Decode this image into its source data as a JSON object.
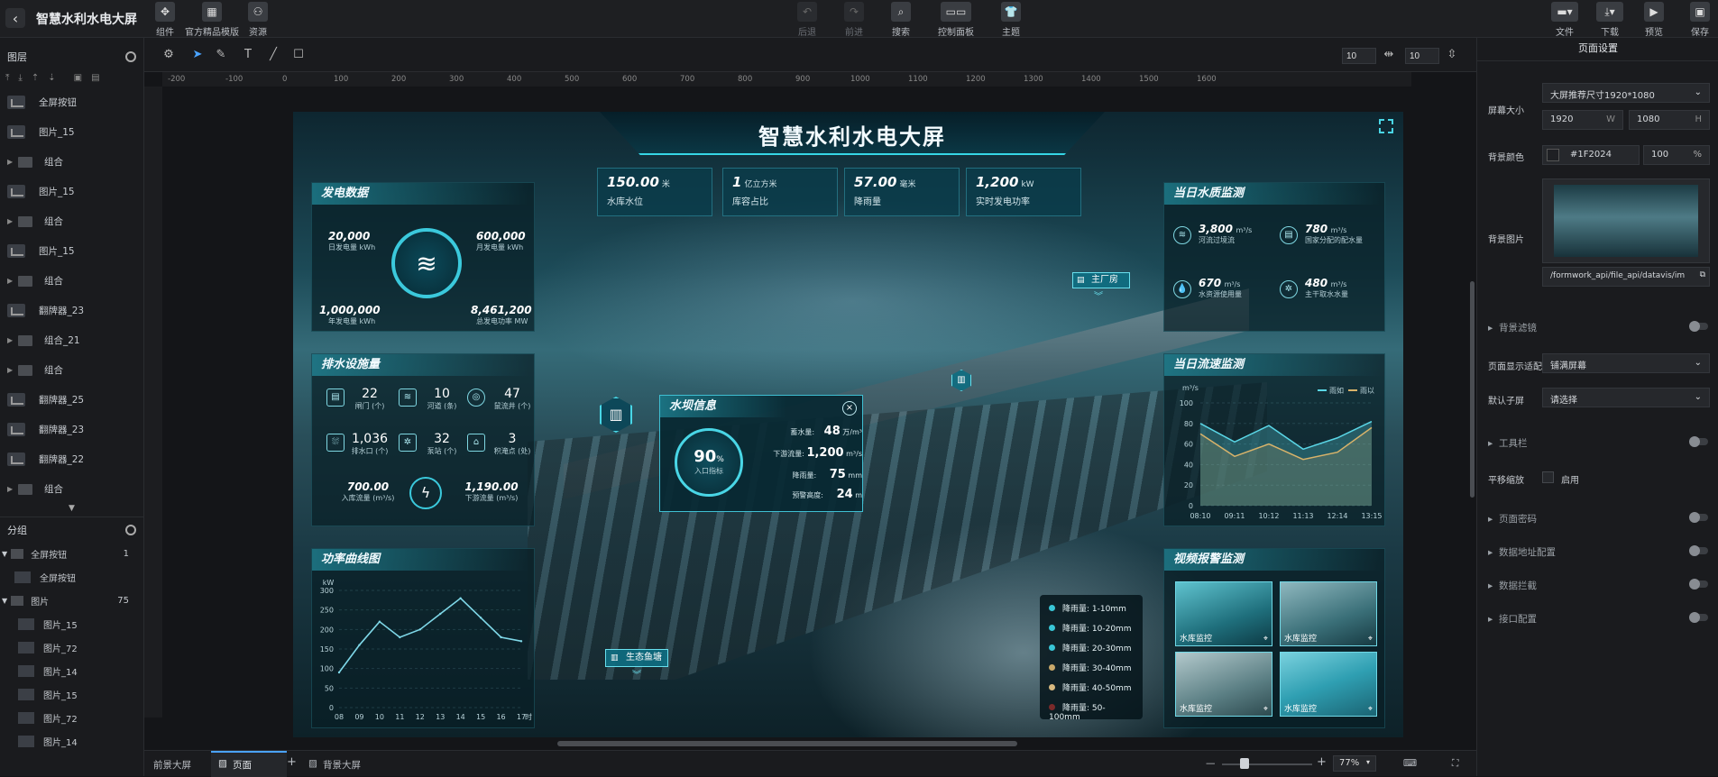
{
  "app": {
    "title": "智慧水利水电大屏"
  },
  "toolbar": {
    "left": [
      "组件",
      "官方精品模版",
      "资源"
    ],
    "center": [
      "后退",
      "前进",
      "搜索",
      "控制面板",
      "主题"
    ],
    "right": [
      "文件",
      "下载",
      "预览",
      "保存"
    ]
  },
  "layers": {
    "title": "图层",
    "items": [
      "全屏按钮",
      "图片_15",
      "组合",
      "图片_15",
      "组合",
      "图片_15",
      "组合",
      "翻牌器_23",
      "组合_21",
      "组合",
      "翻牌器_25",
      "翻牌器_23",
      "翻牌器_22",
      "组合"
    ]
  },
  "groups": {
    "title": "分组",
    "g1": {
      "label": "全屏按钮",
      "count": "1",
      "child": "全屏按钮"
    },
    "g2": {
      "label": "图片",
      "count": "75",
      "children": [
        "图片_15",
        "图片_72",
        "图片_14",
        "图片_15",
        "图片_72",
        "图片_14"
      ]
    }
  },
  "canvas_controls": {
    "gap_x": "10",
    "gap_y": "10"
  },
  "ruler": [
    "-200",
    "-100",
    "0",
    "100",
    "200",
    "300",
    "400",
    "500",
    "600",
    "700",
    "800",
    "900",
    "1000",
    "1100",
    "1200",
    "1300",
    "1400",
    "1500",
    "1600"
  ],
  "screen": {
    "title": "智慧水利水电大屏",
    "top_stats": [
      {
        "value": "150.00",
        "unit": "米",
        "label": "水库水位"
      },
      {
        "value": "1",
        "unit": "亿立方米",
        "label": "库容占比"
      },
      {
        "value": "57.00",
        "unit": "毫米",
        "label": "降雨量"
      },
      {
        "value": "1,200",
        "unit": "kW",
        "label": "实时发电功率"
      }
    ],
    "power": {
      "title": "发电数据",
      "items": [
        {
          "value": "20,000",
          "label": "日发电量 kWh"
        },
        {
          "value": "600,000",
          "label": "月发电量 kWh"
        },
        {
          "value": "1,000,000",
          "label": "年发电量 kWh"
        },
        {
          "value": "8,461,200",
          "label": "总发电功率 MW"
        }
      ]
    },
    "drainage": {
      "title": "排水设施量",
      "items": [
        {
          "value": "22",
          "label": "闸门 (个)"
        },
        {
          "value": "10",
          "label": "河道 (条)"
        },
        {
          "value": "47",
          "label": "鼠流井 (个)"
        },
        {
          "value": "1,036",
          "label": "排水口 (个)"
        },
        {
          "value": "32",
          "label": "泵站 (个)"
        },
        {
          "value": "3",
          "label": "积淹点 (处)"
        }
      ],
      "inflow": {
        "value": "700.00",
        "label": "入库流量 (m³/s)"
      },
      "outflow": {
        "value": "1,190.00",
        "label": "下游流量 (m³/s)"
      }
    },
    "power_curve": {
      "title": "功率曲线图",
      "unit": "kW"
    },
    "water_quality": {
      "title": "当日水质监测",
      "items": [
        {
          "value": "3,800",
          "unit": "m³/s",
          "label": "河流过境流"
        },
        {
          "value": "780",
          "unit": "m³/s",
          "label": "国家分配的配水量"
        },
        {
          "value": "670",
          "unit": "m³/s",
          "label": "水资源使用量"
        },
        {
          "value": "480",
          "unit": "m³/s",
          "label": "主干取水水量"
        }
      ]
    },
    "flow_monitor": {
      "title": "当日流速监测",
      "unit": "m³/s"
    },
    "video": {
      "title": "视频报警监测",
      "cams": [
        "水库监控",
        "水库监控",
        "水库监控",
        "水库监控"
      ]
    },
    "reservoir": {
      "title": "水坝信息",
      "percent": "90",
      "percent_unit": "%",
      "percent_label": "入口指标",
      "rows": [
        {
          "label": "蓄水量:",
          "value": "48",
          "unit": "万/m³"
        },
        {
          "label": "下游流量:",
          "value": "1,200",
          "unit": "m³/s"
        },
        {
          "label": "降雨量:",
          "value": "75",
          "unit": "mm"
        },
        {
          "label": "预警高度:",
          "value": "24",
          "unit": "m"
        }
      ]
    },
    "markers": {
      "main_plant": "主厂房",
      "eco_fish": "生态鱼塘"
    },
    "rain_legend": [
      {
        "label": "降雨量: 1-10mm",
        "color": "#39c6d6"
      },
      {
        "label": "降雨量: 10-20mm",
        "color": "#39c6d6"
      },
      {
        "label": "降雨量: 20-30mm",
        "color": "#39c6d6"
      },
      {
        "label": "降雨量: 30-40mm",
        "color": "#c8a86a"
      },
      {
        "label": "降雨量: 40-50mm",
        "color": "#d8b980"
      },
      {
        "label": "降雨量: 50-100mm",
        "color": "#7b2a2a"
      }
    ]
  },
  "chart_data": [
    {
      "type": "line",
      "x": [
        "08",
        "09",
        "10",
        "11",
        "12",
        "13",
        "14",
        "15",
        "16",
        "17"
      ],
      "series": [
        {
          "values": [
            90,
            160,
            220,
            180,
            200,
            240,
            280,
            230,
            180,
            170
          ]
        }
      ],
      "ylabel": "kW",
      "ylim": [
        0,
        300
      ],
      "yticks": [
        "0",
        "50",
        "100",
        "150",
        "200",
        "250",
        "300"
      ],
      "xlabel": "时",
      "color": "#7fd8e8"
    },
    {
      "type": "area",
      "x": [
        "08:10",
        "09:11",
        "10:12",
        "11:13",
        "12:14",
        "13:15"
      ],
      "series": [
        {
          "name": "雨如",
          "values": [
            80,
            62,
            78,
            55,
            66,
            82
          ],
          "color": "#5ad6e6"
        },
        {
          "name": "雨以",
          "values": [
            70,
            48,
            60,
            45,
            52,
            76
          ],
          "color": "#d8b36a"
        }
      ],
      "ylabel": "m³/s",
      "ylim": [
        0,
        100
      ],
      "yticks": [
        "0",
        "20",
        "40",
        "60",
        "80",
        "100"
      ]
    }
  ],
  "right_panel": {
    "tab": "页面设置",
    "screen_size_label": "屏幕大小",
    "screen_size_value": "大屏推荐尺寸1920*1080",
    "width": "1920",
    "width_unit": "W",
    "height": "1080",
    "height_unit": "H",
    "bg_color_label": "背景颜色",
    "bg_color": "#1F2024",
    "bg_opacity": "100",
    "bg_opacity_unit": "%",
    "bg_image_label": "背景图片",
    "bg_image_path": "/formwork_api/file_api/datavis/im",
    "bg_filter": "背景滤镜",
    "fit_label": "页面显示适配",
    "fit_value": "铺满屏幕",
    "default_sub_label": "默认子屏",
    "default_sub_value": "请选择",
    "toolbar_label": "工具栏",
    "pan_label": "平移缩放",
    "pan_check": "启用",
    "collapsibles": [
      "页面密码",
      "数据地址配置",
      "数据拦截",
      "接口配置"
    ]
  },
  "bottom": {
    "tabs": [
      "前景大屏",
      "页面",
      "背景大屏"
    ],
    "zoom": "77%"
  }
}
